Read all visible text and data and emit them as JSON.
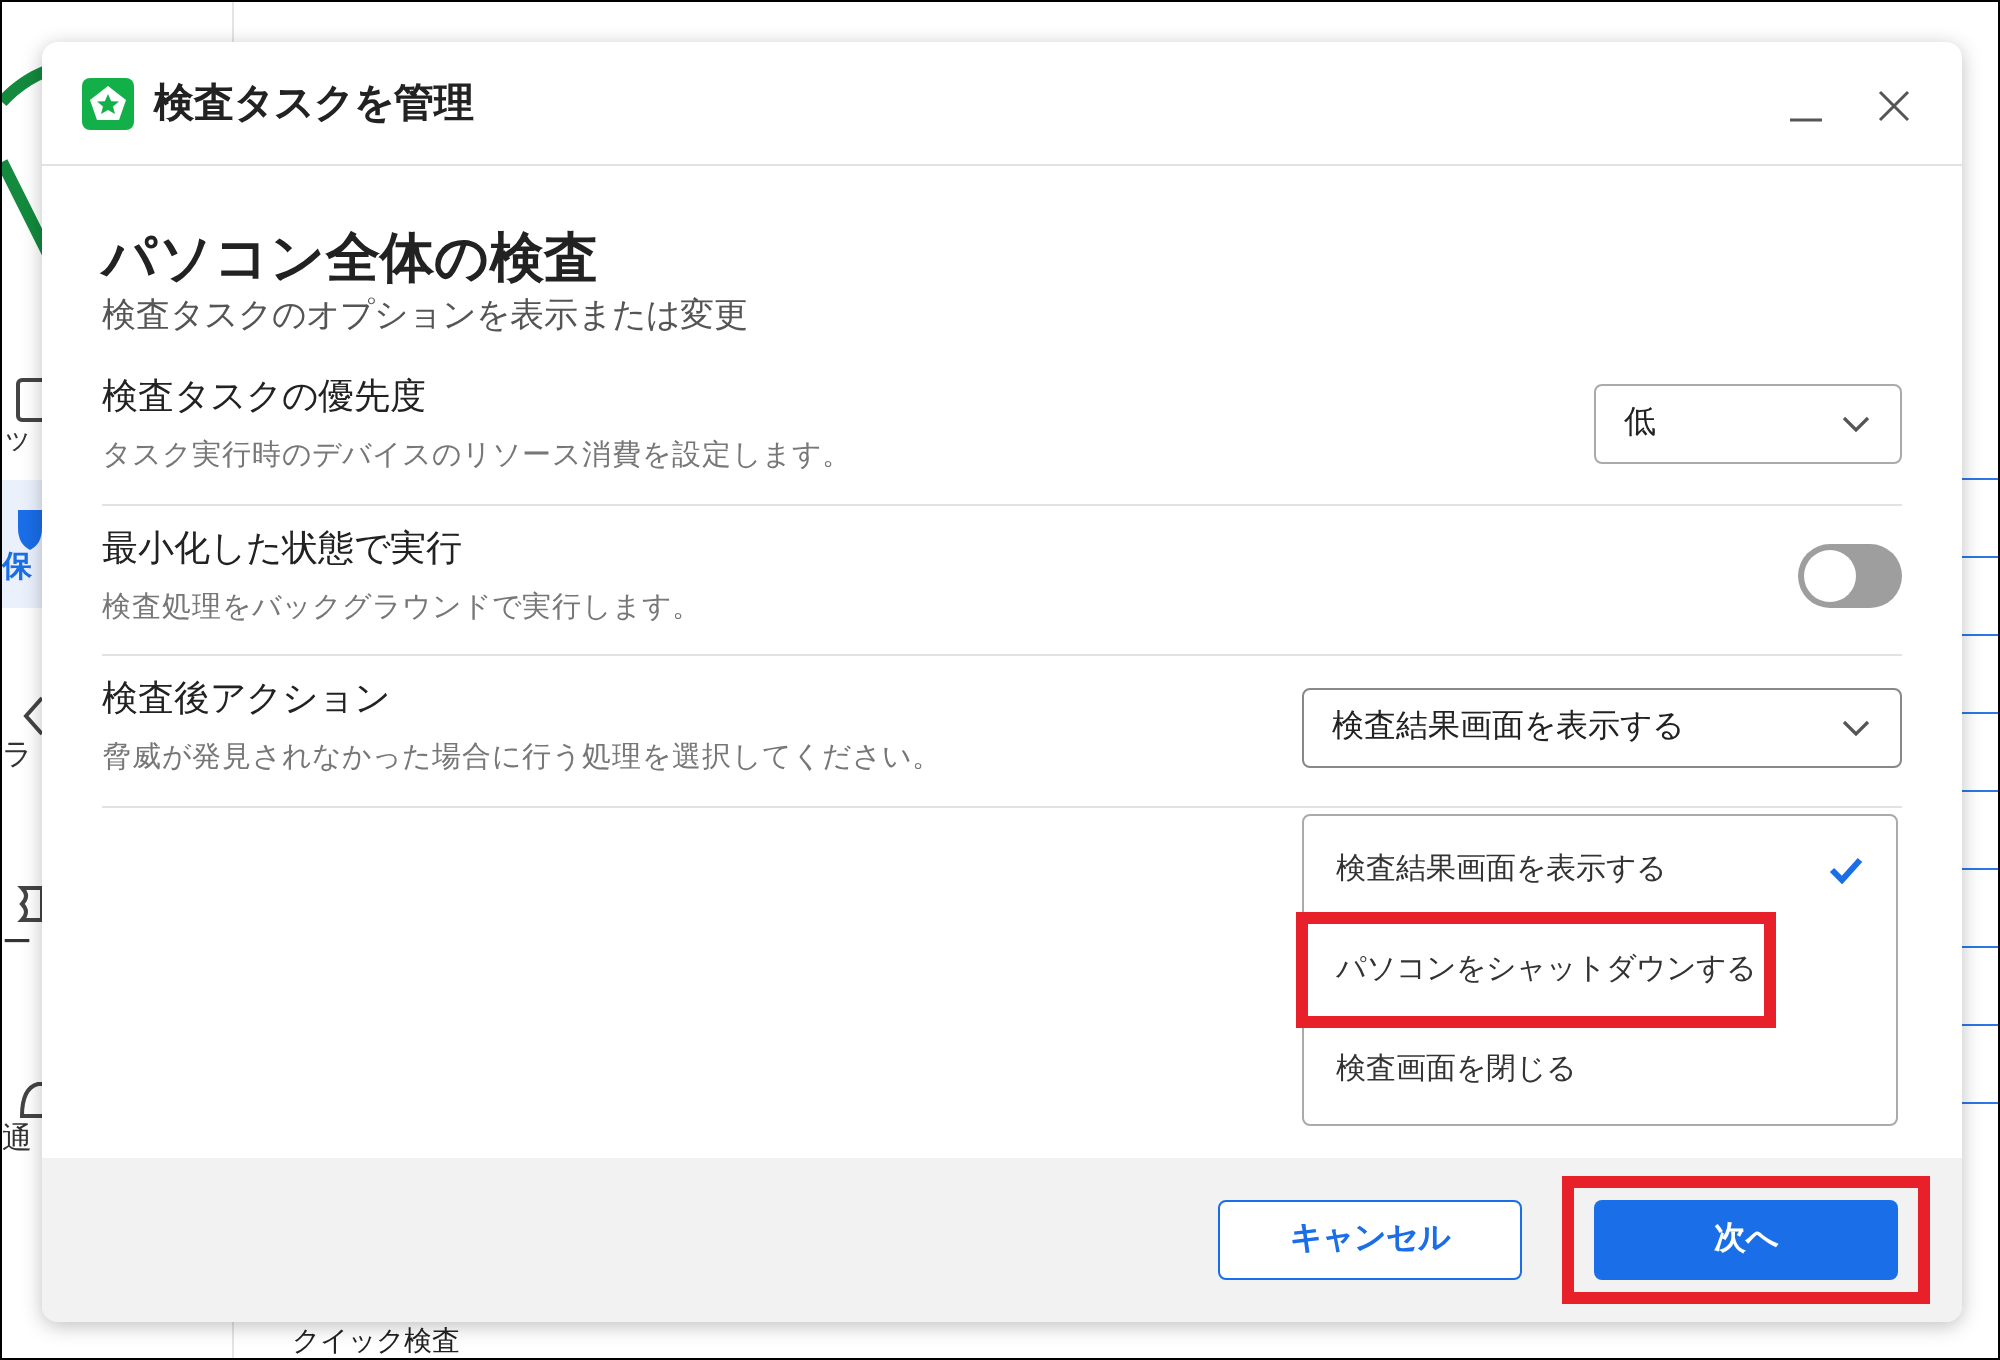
{
  "background": {
    "sidebar_items": [
      {
        "label": "ッ",
        "selected": false
      },
      {
        "label": "保",
        "selected": true
      },
      {
        "label": "ラ",
        "selected": false
      },
      {
        "label": "ー",
        "selected": false
      },
      {
        "label": "通",
        "selected": false
      }
    ],
    "bottom_label": "クイック検査"
  },
  "dialog": {
    "title": "検査タスクを管理",
    "heading": "パソコン全体の検査",
    "subtitle": "検査タスクのオプションを表示または変更",
    "settings": [
      {
        "kind": "select",
        "label": "検査タスクの優先度",
        "description": "タスク実行時のデバイスのリソース消費を設定します。",
        "value": "低",
        "expanded": false
      },
      {
        "kind": "toggle",
        "label": "最小化した状態で実行",
        "description": "検査処理をバックグラウンドで実行します。",
        "on": false
      },
      {
        "kind": "select",
        "label": "検査後アクション",
        "description": "脅威が発見されなかった場合に行う処理を選択してください。",
        "value": "検査結果画面を表示する",
        "expanded": true,
        "options": [
          {
            "label": "検査結果画面を表示する",
            "selected": true,
            "highlighted": false
          },
          {
            "label": "パソコンをシャットダウンする",
            "selected": false,
            "highlighted": true
          },
          {
            "label": "検査画面を閉じる",
            "selected": false,
            "highlighted": false
          }
        ]
      }
    ],
    "buttons": [
      {
        "kind": "secondary",
        "label": "キャンセル",
        "highlighted": false
      },
      {
        "kind": "primary",
        "label": "次へ",
        "highlighted": true
      }
    ]
  }
}
